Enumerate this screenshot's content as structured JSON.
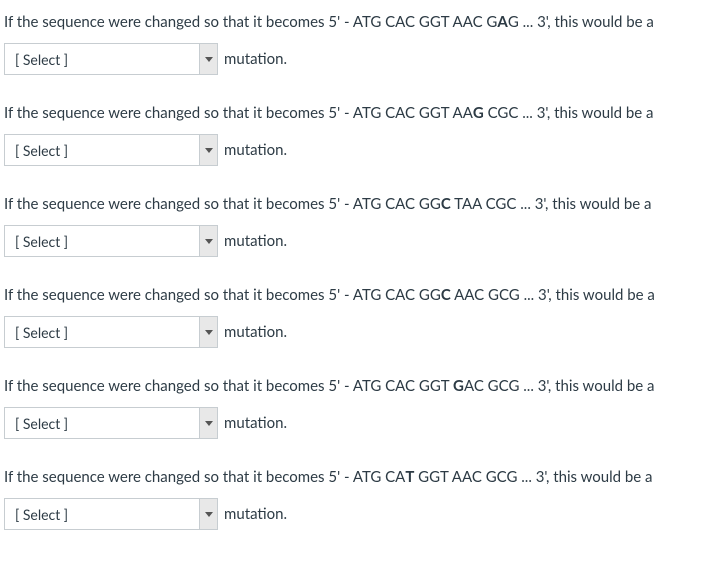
{
  "common": {
    "prefix": "If the sequence were changed so that it becomes 5' - ",
    "suffix_after_seq": " ... 3', this would be a",
    "select_placeholder": "[ Select ]",
    "mutation_label": "mutation."
  },
  "questions": [
    {
      "seq_parts": [
        {
          "t": "ATG CAC GGT AAC G",
          "b": false
        },
        {
          "t": "A",
          "b": true
        },
        {
          "t": "G",
          "b": false
        }
      ]
    },
    {
      "seq_parts": [
        {
          "t": "ATG CAC GGT AA",
          "b": false
        },
        {
          "t": "G",
          "b": true
        },
        {
          "t": " CGC",
          "b": false
        }
      ]
    },
    {
      "seq_parts": [
        {
          "t": "ATG CAC GG",
          "b": false
        },
        {
          "t": "C",
          "b": true
        },
        {
          "t": " TAA CGC",
          "b": false
        }
      ]
    },
    {
      "seq_parts": [
        {
          "t": "ATG CAC GG",
          "b": false
        },
        {
          "t": "C",
          "b": true
        },
        {
          "t": " AAC GCG",
          "b": false
        }
      ]
    },
    {
      "seq_parts": [
        {
          "t": "ATG CAC GGT ",
          "b": false
        },
        {
          "t": "G",
          "b": true
        },
        {
          "t": "AC GCG",
          "b": false
        }
      ]
    },
    {
      "seq_parts": [
        {
          "t": "ATG CA",
          "b": false
        },
        {
          "t": "T",
          "b": true
        },
        {
          "t": " GGT AAC GCG",
          "b": false
        }
      ]
    }
  ]
}
